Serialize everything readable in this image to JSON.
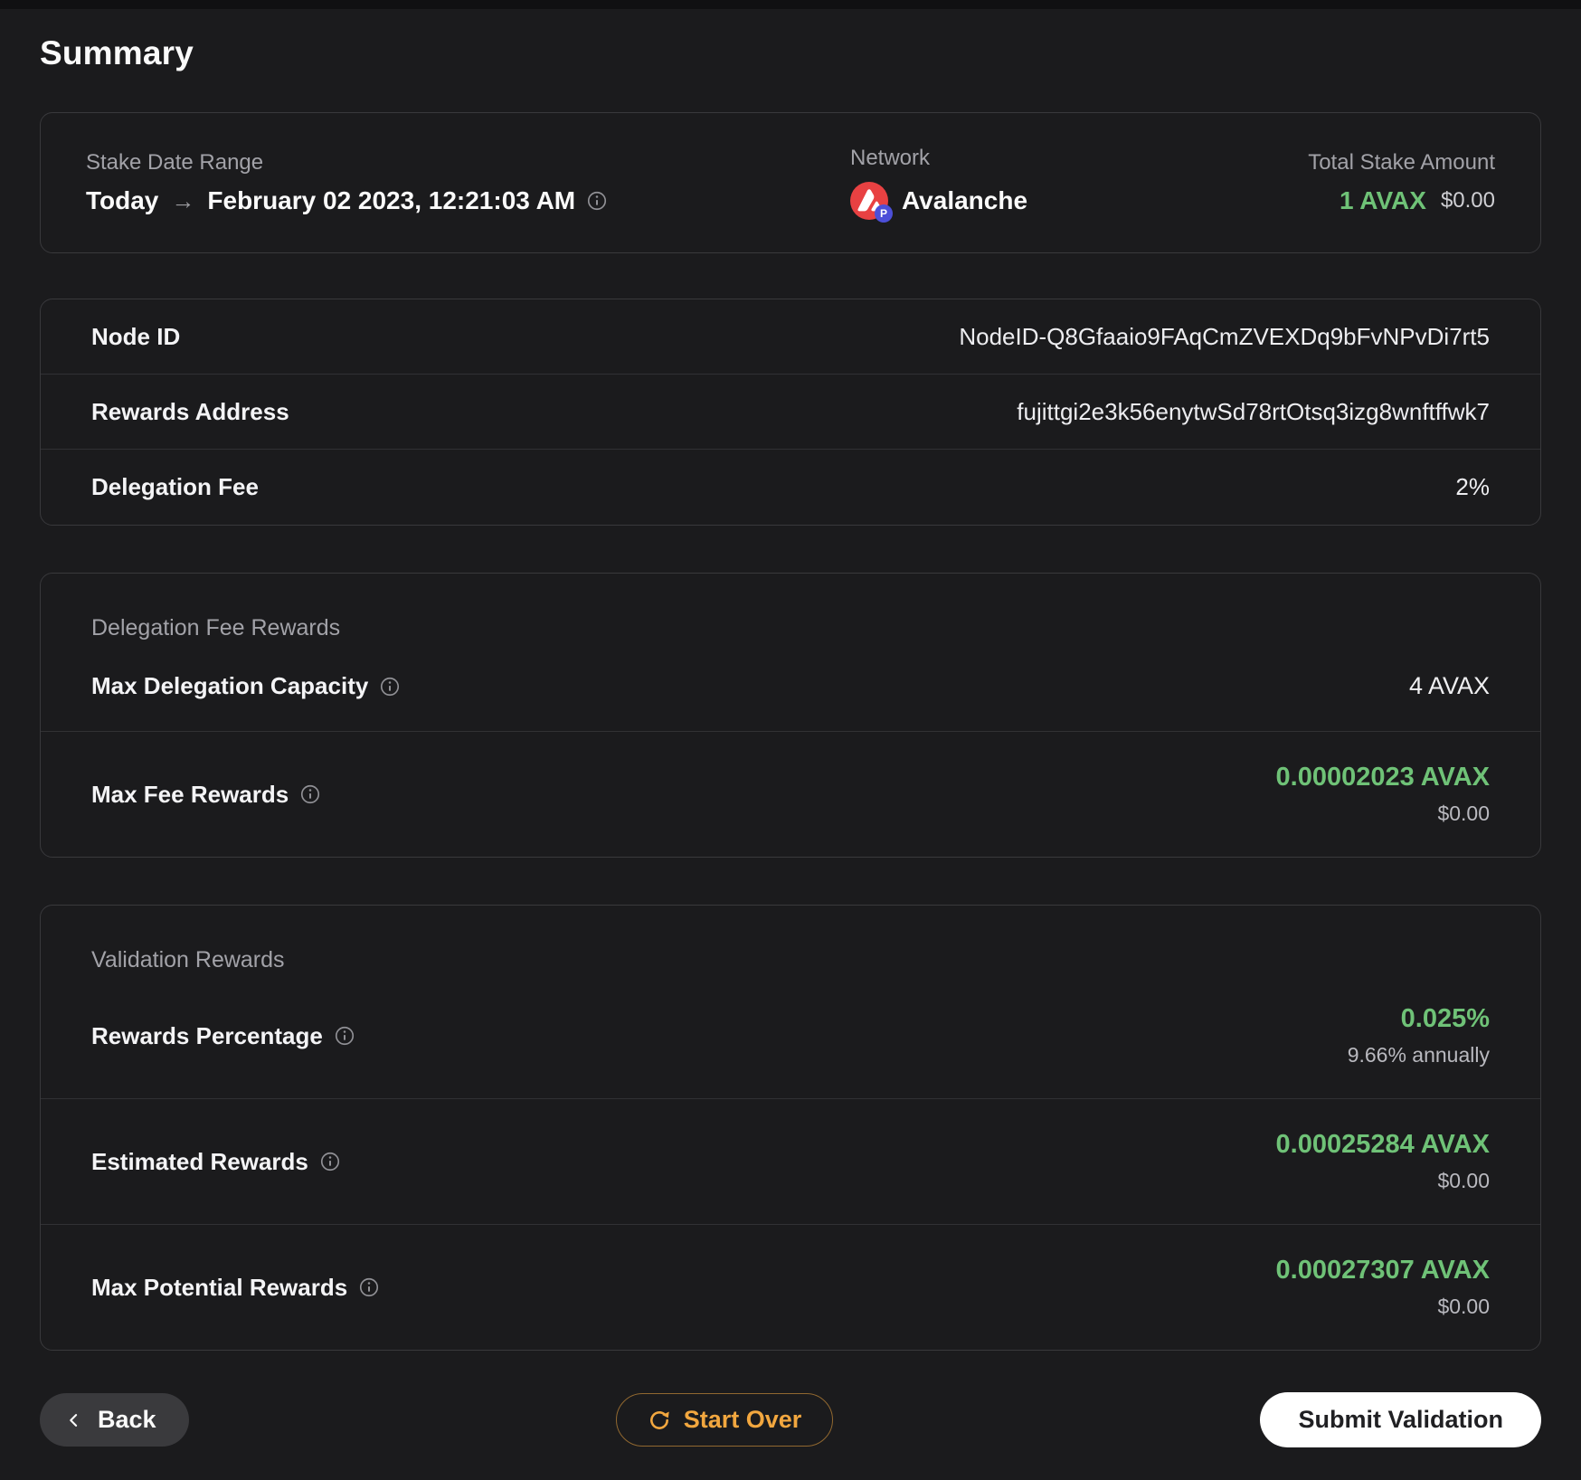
{
  "title": "Summary",
  "colors": {
    "accent_green": "#6fc277",
    "accent_amber": "#f2a73f",
    "avalanche_red": "#e84142",
    "badge_purple": "#4c4fd8",
    "background": "#1b1b1d"
  },
  "overview": {
    "stake_date_range": {
      "label": "Stake Date Range",
      "from": "Today",
      "arrow": "→",
      "to": "February 02 2023, 12:21:03 AM"
    },
    "network": {
      "label": "Network",
      "value": "Avalanche",
      "icon": "avalanche-logo",
      "badge": "P"
    },
    "total_stake": {
      "label": "Total Stake Amount",
      "amount": "1 AVAX",
      "usd": "$0.00"
    }
  },
  "details": {
    "rows": [
      {
        "label": "Node ID",
        "value": "NodeID-Q8Gfaaio9FAqCmZVEXDq9bFvNPvDi7rt5"
      },
      {
        "label": "Rewards Address",
        "value": "fujittgi2e3k56enytwSd78rtOtsq3izg8wnftffwk7"
      },
      {
        "label": "Delegation Fee",
        "value": "2%"
      }
    ]
  },
  "delegation_fee_rewards": {
    "title": "Delegation Fee Rewards",
    "capacity": {
      "label": "Max Delegation Capacity",
      "value": "4 AVAX"
    },
    "max_fee": {
      "label": "Max Fee Rewards",
      "value": "0.00002023 AVAX",
      "usd": "$0.00"
    }
  },
  "validation_rewards": {
    "title": "Validation Rewards",
    "rows": [
      {
        "label": "Rewards Percentage",
        "value": "0.025%",
        "sub": "9.66% annually"
      },
      {
        "label": "Estimated Rewards",
        "value": "0.00025284 AVAX",
        "sub": "$0.00"
      },
      {
        "label": "Max Potential Rewards",
        "value": "0.00027307 AVAX",
        "sub": "$0.00"
      }
    ]
  },
  "footer": {
    "back": "Back",
    "start_over": "Start Over",
    "submit": "Submit Validation"
  }
}
